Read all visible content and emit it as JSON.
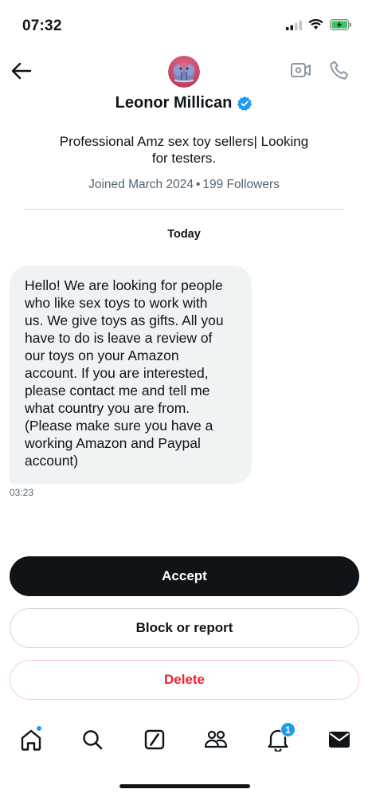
{
  "status_bar": {
    "time": "07:32",
    "icons": [
      "signal-icon",
      "wifi-icon",
      "battery-charging-icon"
    ]
  },
  "header": {
    "back_icon": "arrow-left-icon",
    "avatar": "avatar",
    "display_name": "Leonor Millican",
    "verified_icon": "verified-badge-icon",
    "video_icon": "video-call-icon",
    "phone_icon": "phone-icon"
  },
  "profile": {
    "bio_line1": "Professional Amz sex toy sellers| Looking",
    "bio_line2": "for testers.",
    "joined": "Joined March 2024",
    "separator": "•",
    "followers": "199 Followers"
  },
  "conversation": {
    "day_label": "Today",
    "messages": [
      {
        "lines": [
          "Hello! We are looking for people",
          "who like sex toys to work with",
          "us. We give toys as gifts. All you",
          "have to do is leave a review of",
          "our toys on your Amazon",
          "account. If you are interested,",
          "please contact me and tell me",
          "what country you are from.",
          "(Please make sure you have a",
          "working Amazon and Paypal",
          "account)"
        ],
        "time": "03:23"
      }
    ]
  },
  "request_actions": {
    "accept_label": "Accept",
    "block_label": "Block or report",
    "delete_label": "Delete"
  },
  "tabbar": {
    "items": [
      {
        "name": "home",
        "icon": "home-icon",
        "has_dot": true
      },
      {
        "name": "search",
        "icon": "search-icon"
      },
      {
        "name": "grok",
        "icon": "grok-icon"
      },
      {
        "name": "communities",
        "icon": "communities-icon"
      },
      {
        "name": "notifications",
        "icon": "bell-icon",
        "badge": "1"
      },
      {
        "name": "messages",
        "icon": "mail-icon",
        "active": true
      }
    ]
  },
  "colors": {
    "accent": "#1d9bf0",
    "text": "#0f1419",
    "muted": "#536471",
    "bubble": "#eff3f4",
    "danger": "#f4212e",
    "battery": "#34c759"
  }
}
